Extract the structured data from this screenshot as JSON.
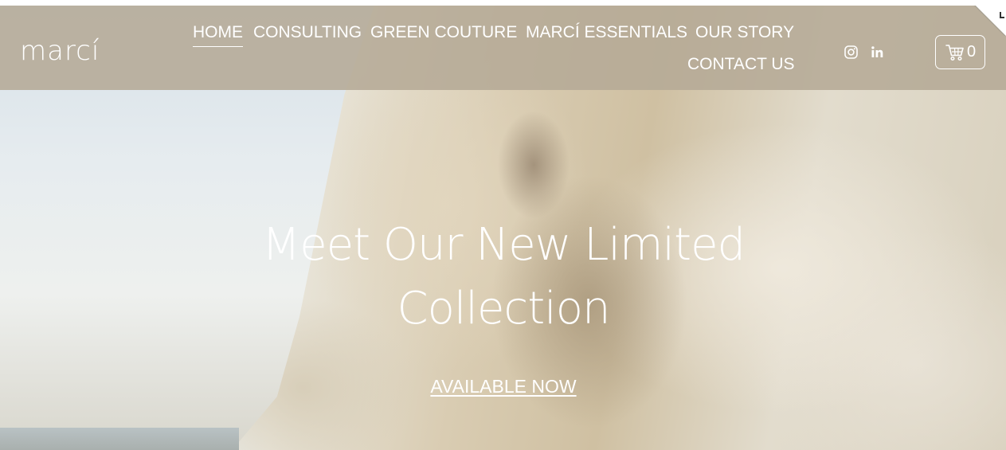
{
  "brand": {
    "logo_text": "marcí"
  },
  "nav": {
    "items": [
      {
        "label": "HOME",
        "active": true
      },
      {
        "label": "CONSULTING",
        "active": false
      },
      {
        "label": "GREEN COUTURE",
        "active": false
      },
      {
        "label": "MARCÍ ESSENTIALS",
        "active": false
      },
      {
        "label": "OUR STORY",
        "active": false
      },
      {
        "label": "CONTACT US",
        "active": false
      }
    ]
  },
  "social": {
    "icons": [
      "instagram-icon",
      "linkedin-icon"
    ]
  },
  "cart": {
    "icon": "cart-icon",
    "count": "0"
  },
  "hero": {
    "headline": "Meet Our New Limited Collection",
    "cta_label": "AVAILABLE NOW"
  },
  "colors": {
    "header_bg": "#b5aa96",
    "text": "#ffffff"
  }
}
